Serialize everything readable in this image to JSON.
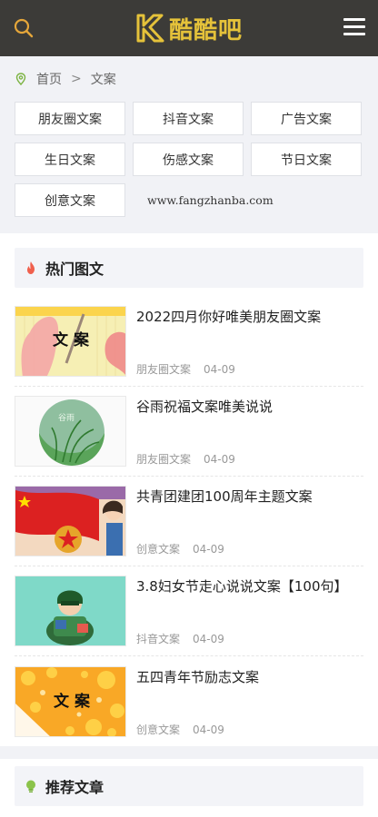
{
  "header": {
    "logo_text": "酷酷吧",
    "logo_letter": "K"
  },
  "breadcrumb": {
    "home": "首页",
    "separator": ">",
    "current": "文案"
  },
  "categories": [
    "朋友圈文案",
    "抖音文案",
    "广告文案",
    "生日文案",
    "伤感文案",
    "节日文案",
    "创意文案"
  ],
  "site_url": "www.fangzhanba.com",
  "hot": {
    "title": "热门图文",
    "items": [
      {
        "title": "2022四月你好唯美朋友圈文案",
        "category": "朋友圈文案",
        "date": "04-09",
        "thumb_text": "文 案"
      },
      {
        "title": "谷雨祝福文案唯美说说",
        "category": "朋友圈文案",
        "date": "04-09",
        "thumb_text": "谷雨"
      },
      {
        "title": "共青团建团100周年主题文案",
        "category": "创意文案",
        "date": "04-09"
      },
      {
        "title": "3.8妇女节走心说说文案【100句】",
        "category": "抖音文案",
        "date": "04-09"
      },
      {
        "title": "五四青年节励志文案",
        "category": "创意文案",
        "date": "04-09",
        "thumb_text": "文 案"
      }
    ]
  },
  "recommend": {
    "title": "推荐文章"
  },
  "colors": {
    "header_bg": "#3c3b38",
    "logo_gold": "#e5c23a",
    "menu_icon": "#ffffff",
    "flame": "#f0604d",
    "bulb": "#8bc34a"
  }
}
